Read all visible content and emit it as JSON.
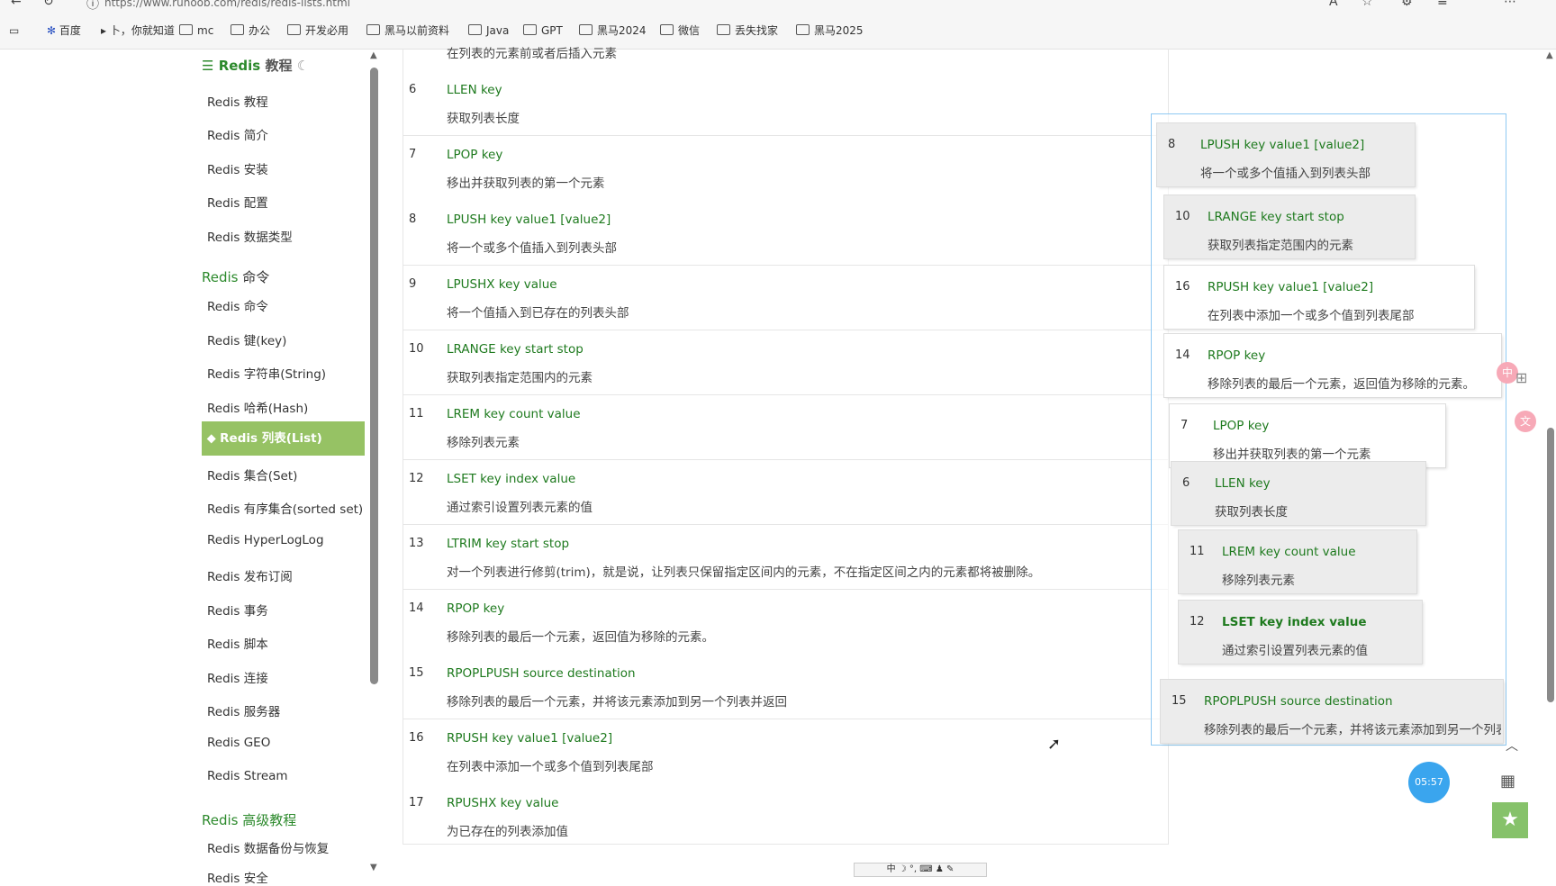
{
  "browser": {
    "url": "https://www.runoob.com/redis/redis-lists.html",
    "bookmarks": [
      {
        "label": "百度",
        "icon": "paw-icon"
      },
      {
        "label": "卜，你就知道",
        "icon": "page-icon"
      },
      {
        "label": "mc",
        "icon": "folder-icon"
      },
      {
        "label": "办公",
        "icon": "folder-icon"
      },
      {
        "label": "开发必用",
        "icon": "folder-icon"
      },
      {
        "label": "黑马以前资料",
        "icon": "folder-icon"
      },
      {
        "label": "Java",
        "icon": "folder-icon"
      },
      {
        "label": "GPT",
        "icon": "folder-icon"
      },
      {
        "label": "黑马2024",
        "icon": "folder-icon"
      },
      {
        "label": "微信",
        "icon": "folder-icon"
      },
      {
        "label": "丢失找家",
        "icon": "folder-icon"
      },
      {
        "label": "黑马2025",
        "icon": "folder-icon"
      }
    ]
  },
  "sidebar": {
    "title_en": "Redis",
    "title_cn": "教程",
    "items_tutorial": [
      "Redis 教程",
      "Redis 简介",
      "Redis 安装",
      "Redis 配置",
      "Redis 数据类型"
    ],
    "section_commands_en": "Redis",
    "section_commands_cn": "命令",
    "items_commands": [
      "Redis 命令",
      "Redis 键(key)",
      "Redis 字符串(String)",
      "Redis 哈希(Hash)"
    ],
    "active_item": "Redis 列表(List)",
    "items_after": [
      "Redis 集合(Set)",
      "Redis 有序集合(sorted set)",
      "Redis HyperLogLog",
      "Redis 发布订阅",
      "Redis 事务",
      "Redis 脚本",
      "Redis 连接",
      "Redis 服务器",
      "Redis GEO",
      "Redis Stream"
    ],
    "section_advanced_en": "Redis",
    "section_advanced_cn": "高级教程",
    "items_advanced": [
      "Redis 数据备份与恢复",
      "Redis 安全"
    ]
  },
  "table": {
    "top_partial": "在列表的元素前或者后插入元素",
    "rows": [
      {
        "num": "6",
        "cmd": "LLEN key",
        "desc": "获取列表长度"
      },
      {
        "num": "7",
        "cmd": "LPOP key",
        "desc": "移出并获取列表的第一个元素"
      },
      {
        "num": "8",
        "cmd": "LPUSH key value1 [value2]",
        "desc": "将一个或多个值插入到列表头部"
      },
      {
        "num": "9",
        "cmd": "LPUSHX key value",
        "desc": "将一个值插入到已存在的列表头部"
      },
      {
        "num": "10",
        "cmd": "LRANGE key start stop",
        "desc": "获取列表指定范围内的元素"
      },
      {
        "num": "11",
        "cmd": "LREM key count value",
        "desc": "移除列表元素"
      },
      {
        "num": "12",
        "cmd": "LSET key index value",
        "desc": "通过索引设置列表元素的值"
      },
      {
        "num": "13",
        "cmd": "LTRIM key start stop",
        "desc": "对一个列表进行修剪(trim)，就是说，让列表只保留指定区间内的元素，不在指定区间之内的元素都将被删除。"
      },
      {
        "num": "14",
        "cmd": "RPOP key",
        "desc": "移除列表的最后一个元素，返回值为移除的元素。"
      },
      {
        "num": "15",
        "cmd": "RPOPLPUSH source destination",
        "desc": "移除列表的最后一个元素，并将该元素添加到另一个列表并返回"
      },
      {
        "num": "16",
        "cmd": "RPUSH key value1 [value2]",
        "desc": "在列表中添加一个或多个值到列表尾部"
      },
      {
        "num": "17",
        "cmd": "RPUSHX key value",
        "desc": "为已存在的列表添加值"
      }
    ]
  },
  "overlay_cards": [
    {
      "num": "8",
      "cmd": "LPUSH key value1 [value2]",
      "desc": "将一个或多个值插入到列表头部"
    },
    {
      "num": "10",
      "cmd": "LRANGE key start stop",
      "desc": "获取列表指定范围内的元素"
    },
    {
      "num": "16",
      "cmd": "RPUSH key value1 [value2]",
      "desc": "在列表中添加一个或多个值到列表尾部"
    },
    {
      "num": "14",
      "cmd": "RPOP key",
      "desc": "移除列表的最后一个元素，返回值为移除的元素。"
    },
    {
      "num": "7",
      "cmd": "LPOP key",
      "desc": "移出并获取列表的第一个元素"
    },
    {
      "num": "6",
      "cmd": "LLEN key",
      "desc": "获取列表长度"
    },
    {
      "num": "11",
      "cmd": "LREM key count value",
      "desc": "移除列表元素"
    },
    {
      "num": "12",
      "cmd": "LSET key index value",
      "desc": "通过索引设置列表元素的值"
    },
    {
      "num": "15",
      "cmd": "RPOPLPUSH source destination",
      "desc": "移除列表的最后一个元素，并将该元素添加到另一个列表并返回"
    }
  ],
  "widgets": {
    "timer": "05:57",
    "ime_bar": "中 ☽ °, ⌨ ♟ ✎",
    "accent": "#96c264",
    "link_green": "#1e7a1e"
  }
}
